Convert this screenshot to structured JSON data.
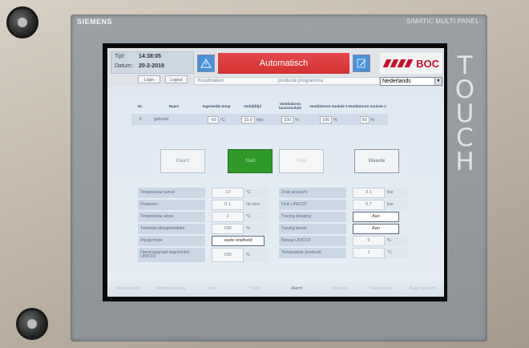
{
  "panel": {
    "brand": "SIEMENS",
    "model": "SIMATIC MULTI PANEL",
    "touch_label": "TOUCH"
  },
  "header": {
    "time_label": "Tijd:",
    "time_value": "14:38:05",
    "date_label": "Datum:",
    "date_value": "20-2-2019",
    "login_label": "Login",
    "logout_label": "Logout",
    "mode_title": "Automatisch",
    "logo_text": "BOC",
    "sub_left": "Koudmaken",
    "sub_right": "producte programma",
    "language": "Nederlands"
  },
  "table": {
    "headers": [
      "Nr.",
      "Naam",
      "Ingestelde temp",
      "Verblijftijd",
      "Ventilatoren basismodule",
      "Ventilatoren module 1",
      "Ventilatoren module 2"
    ],
    "row": {
      "nr": "3",
      "naam": "gekruid",
      "temp": "-60",
      "temp_unit": "°C",
      "tijd": "10.0",
      "tijd_unit": "min",
      "fan_basis": "100",
      "fan_1": "100",
      "fan_2": "80",
      "pct": "%"
    }
  },
  "actions": {
    "klaar": "Klaarz",
    "start": "Start",
    "stop": "Stop",
    "waarde": "Waarde"
  },
  "left_grid": [
    {
      "name": "Temperatuur tunnel",
      "value": "-17",
      "unit": "°C"
    },
    {
      "name": "Draaiuren",
      "value": "0  1",
      "unit": "hh.mm"
    },
    {
      "name": "Temperatuur afzas",
      "value": "2",
      "unit": "°C"
    },
    {
      "name": "Toerental afzuigventilator",
      "value": "100",
      "unit": "%"
    },
    {
      "name": "Afzuig mode",
      "value": "vaste snelheid",
      "unit": ""
    },
    {
      "name": "Openingsgraad regelventiel LIN/CO2",
      "value": "100",
      "unit": "%"
    }
  ],
  "right_grid": [
    {
      "name": "Druk perslucht",
      "value": "3.1",
      "unit": "bar"
    },
    {
      "name": "Druk LIN/CO2",
      "value": "5.7",
      "unit": "bar"
    },
    {
      "name": "Tracing afzaging",
      "value": "Aan",
      "unit": ""
    },
    {
      "name": "Tracing tunnel",
      "value": "Aan",
      "unit": ""
    },
    {
      "name": "Niveau LIN/CO2",
      "value": "0",
      "unit": "%"
    },
    {
      "name": "Temperatuur perslucht",
      "value": "1",
      "unit": "°C"
    }
  ],
  "footer": [
    "Automatisch",
    "Handbediening",
    "Info",
    "Trend",
    "Alarm",
    "Opslaan",
    "Parameters",
    "Begin scherm"
  ]
}
